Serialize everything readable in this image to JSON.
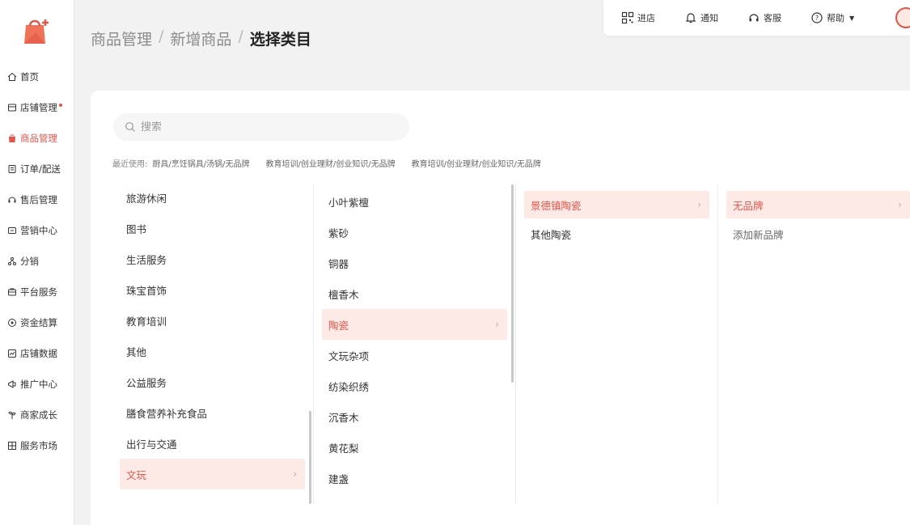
{
  "sidebar": {
    "items": [
      {
        "label": "首页",
        "icon": "home-icon"
      },
      {
        "label": "店铺管理",
        "icon": "store-icon",
        "badge_dot": true
      },
      {
        "label": "商品管理",
        "icon": "bag-icon",
        "active": true
      },
      {
        "label": "订单/配送",
        "icon": "order-icon"
      },
      {
        "label": "售后管理",
        "icon": "aftersale-icon"
      },
      {
        "label": "营销中心",
        "icon": "marketing-icon"
      },
      {
        "label": "分销",
        "icon": "distribution-icon"
      },
      {
        "label": "平台服务",
        "icon": "platform-service-icon"
      },
      {
        "label": "资金结算",
        "icon": "settlement-icon"
      },
      {
        "label": "店铺数据",
        "icon": "data-icon"
      },
      {
        "label": "推广中心",
        "icon": "promotion-icon"
      },
      {
        "label": "商家成长",
        "icon": "growth-icon"
      },
      {
        "label": "服务市场",
        "icon": "market-icon"
      }
    ]
  },
  "breadcrumb": {
    "level1": "商品管理",
    "level2": "新增商品",
    "current": "选择类目",
    "separator": "/"
  },
  "topbar": {
    "enter_store": "进店",
    "notify": "通知",
    "service": "客服",
    "help": "帮助"
  },
  "search": {
    "placeholder": "搜索"
  },
  "recent": {
    "label": "最近使用:",
    "paths": [
      "厨具/烹饪锅具/汤锅/无品牌",
      "教育培训/创业理财/创业知识/无品牌",
      "教育培训/创业理财/创业知识/无品牌"
    ]
  },
  "columns": {
    "col1": [
      "旅游休闲",
      "图书",
      "生活服务",
      "珠宝首饰",
      "教育培训",
      "其他",
      "公益服务",
      "膳食营养补充食品",
      "出行与交通",
      "文玩"
    ],
    "col1_selected": "文玩",
    "col2": [
      "小叶紫檀",
      "紫砂",
      "铜器",
      "檀香木",
      "陶瓷",
      "文玩杂项",
      "纺染织绣",
      "沉香木",
      "黄花梨",
      "建盏"
    ],
    "col2_selected": "陶瓷",
    "col3": [
      "景德镇陶瓷",
      "其他陶瓷"
    ],
    "col3_selected": "景德镇陶瓷",
    "col4": [
      "无品牌",
      "添加新品牌"
    ],
    "col4_selected": "无品牌"
  },
  "colors": {
    "accent": "#e0564a",
    "selected_bg": "#fdeae6"
  }
}
